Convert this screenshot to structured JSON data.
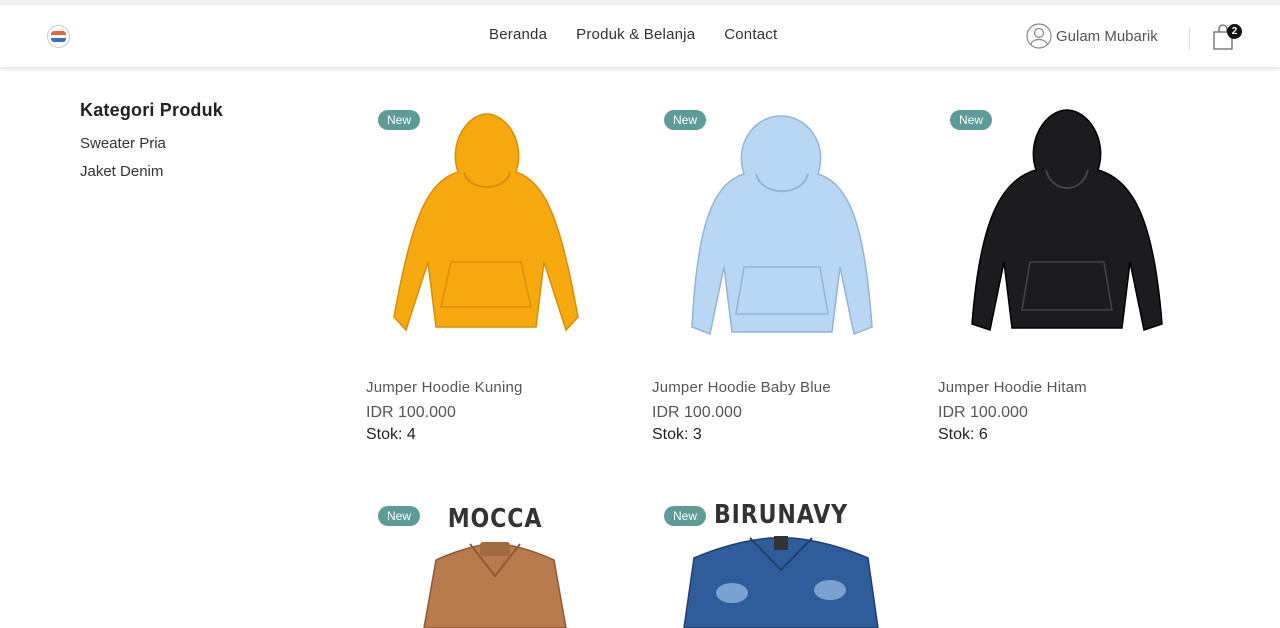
{
  "header": {
    "nav": [
      "Beranda",
      "Produk & Belanja",
      "Contact"
    ],
    "user_name": "Gulam Mubarik",
    "cart_count": "2"
  },
  "sidebar": {
    "title": "Kategori Produk",
    "categories": [
      "Sweater Pria",
      "Jaket Denim"
    ]
  },
  "products": [
    {
      "badge": "New",
      "name": "Jumper Hoodie Kuning",
      "price": "IDR 100.000",
      "stock": "Stok: 4",
      "color": "#f5a90f"
    },
    {
      "badge": "New",
      "name": "Jumper Hoodie Baby Blue",
      "price": "IDR 100.000",
      "stock": "Stok: 3",
      "color": "#b9d6f2"
    },
    {
      "badge": "New",
      "name": "Jumper Hoodie Hitam",
      "price": "IDR 100.000",
      "stock": "Stok: 6",
      "color": "#1c1c1e"
    },
    {
      "badge": "New",
      "brand": "MOCCA",
      "color": "#b87b4e"
    },
    {
      "badge": "New",
      "brand": "BIRUNAVY",
      "color": "#2f5d9c"
    }
  ]
}
